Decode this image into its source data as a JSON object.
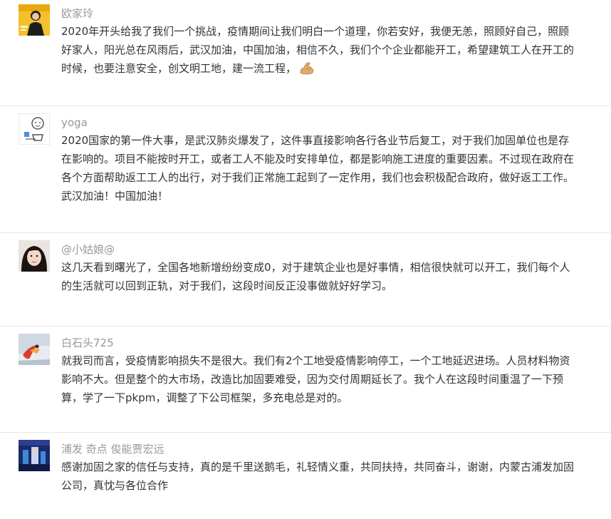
{
  "comments": [
    {
      "username": "欧家玲",
      "lines": [
        "2020年开头给我了我们一个挑战，疫情期间让我们明白一个道理，你若安好，我便无恙，照顾好自己，照顾",
        "好家人，阳光总在风雨后，武汉加油，中国加油，相信不久，我们个个企业都能开工，希望建筑工人在开工的",
        "时候，也要注意安全，创文明工地，建一流工程，"
      ],
      "emoji": "flexed-biceps-icon"
    },
    {
      "username": "yoga",
      "lines": [
        "2020国家的第一件大事，是武汉肺炎爆发了，这件事直接影响各行各业节后复工，对于我们加固单位也是存",
        "在影响的。项目不能按时开工，或者工人不能及时安排单位，都是影响施工进度的重要因素。不过现在政府在",
        "各个方面帮助返工工人的出行，对于我们正常施工起到了一定作用，我们也会积极配合政府，做好返工工作。",
        "武汉加油！中国加油！"
      ]
    },
    {
      "username": "@小姑娘@",
      "lines": [
        "这几天看到曙光了，全国各地新增纷纷变成0，对于建筑企业也是好事情，相信很快就可以开工，我们每个人",
        "的生活就可以回到正轨，对于我们，这段时间反正没事做就好好学习。"
      ]
    },
    {
      "username": "白石头725",
      "lines": [
        "就我司而言，受疫情影响损失不是很大。我们有2个工地受疫情影响停工，一个工地延迟进场。人员材料物资",
        "影响不大。但是整个的大市场，改造比加固要难受，因为交付周期延长了。我个人在这段时间重温了一下预",
        "算，学了一下pkpm，调整了下公司框架，多充电总是对的。"
      ]
    },
    {
      "username": "浦发 奇点 俊能贾宏远",
      "lines": [
        "感谢加固之家的信任与支持，真的是千里送鹅毛，礼轻情义重，共同扶持，共同奋斗，谢谢，内蒙古浦发加固",
        "公司，真忱与各位合作"
      ]
    }
  ]
}
